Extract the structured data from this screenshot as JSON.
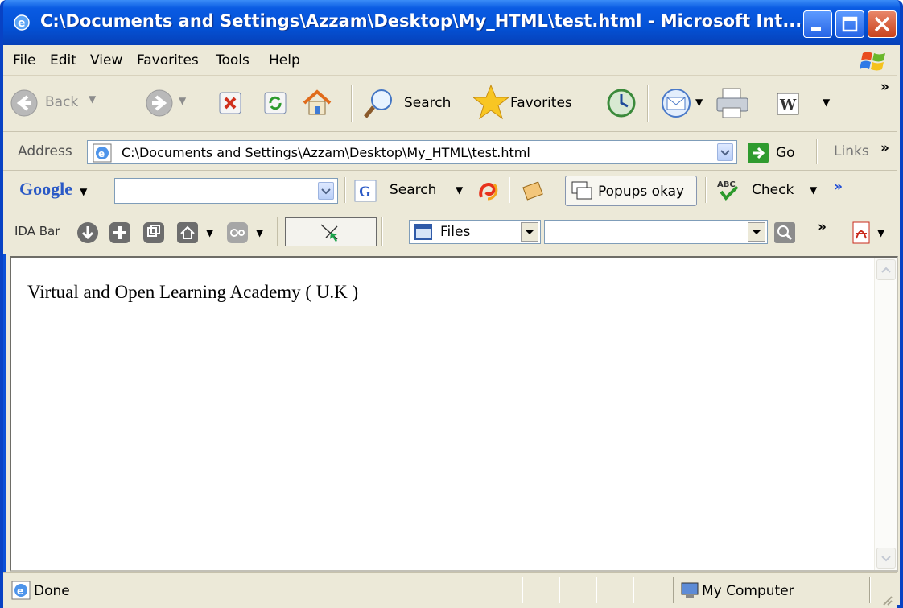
{
  "window": {
    "title": "C:\\Documents and Settings\\Azzam\\Desktop\\My_HTML\\test.html - Microsoft Int..."
  },
  "menu": {
    "file": "File",
    "edit": "Edit",
    "view": "View",
    "favorites": "Favorites",
    "tools": "Tools",
    "help": "Help"
  },
  "toolbar": {
    "back": "Back",
    "search": "Search",
    "favorites": "Favorites",
    "overflow": "»"
  },
  "address": {
    "label": "Address",
    "value": "C:\\Documents and Settings\\Azzam\\Desktop\\My_HTML\\test.html",
    "go": "Go",
    "links": "Links",
    "overflow": "»"
  },
  "google": {
    "logo": "Google",
    "search": "Search",
    "popups": "Popups okay",
    "check": "Check",
    "overflow": "»"
  },
  "ida": {
    "label": "IDA Bar",
    "files": "Files",
    "overflow": "»"
  },
  "page": {
    "text": "Virtual and Open Learning Academy ( U.K )"
  },
  "status": {
    "text": "Done",
    "zone": "My Computer"
  },
  "colors": {
    "titlebar": "#0a5be3",
    "chrome": "#ece9d8",
    "close_button": "#c9421c"
  }
}
